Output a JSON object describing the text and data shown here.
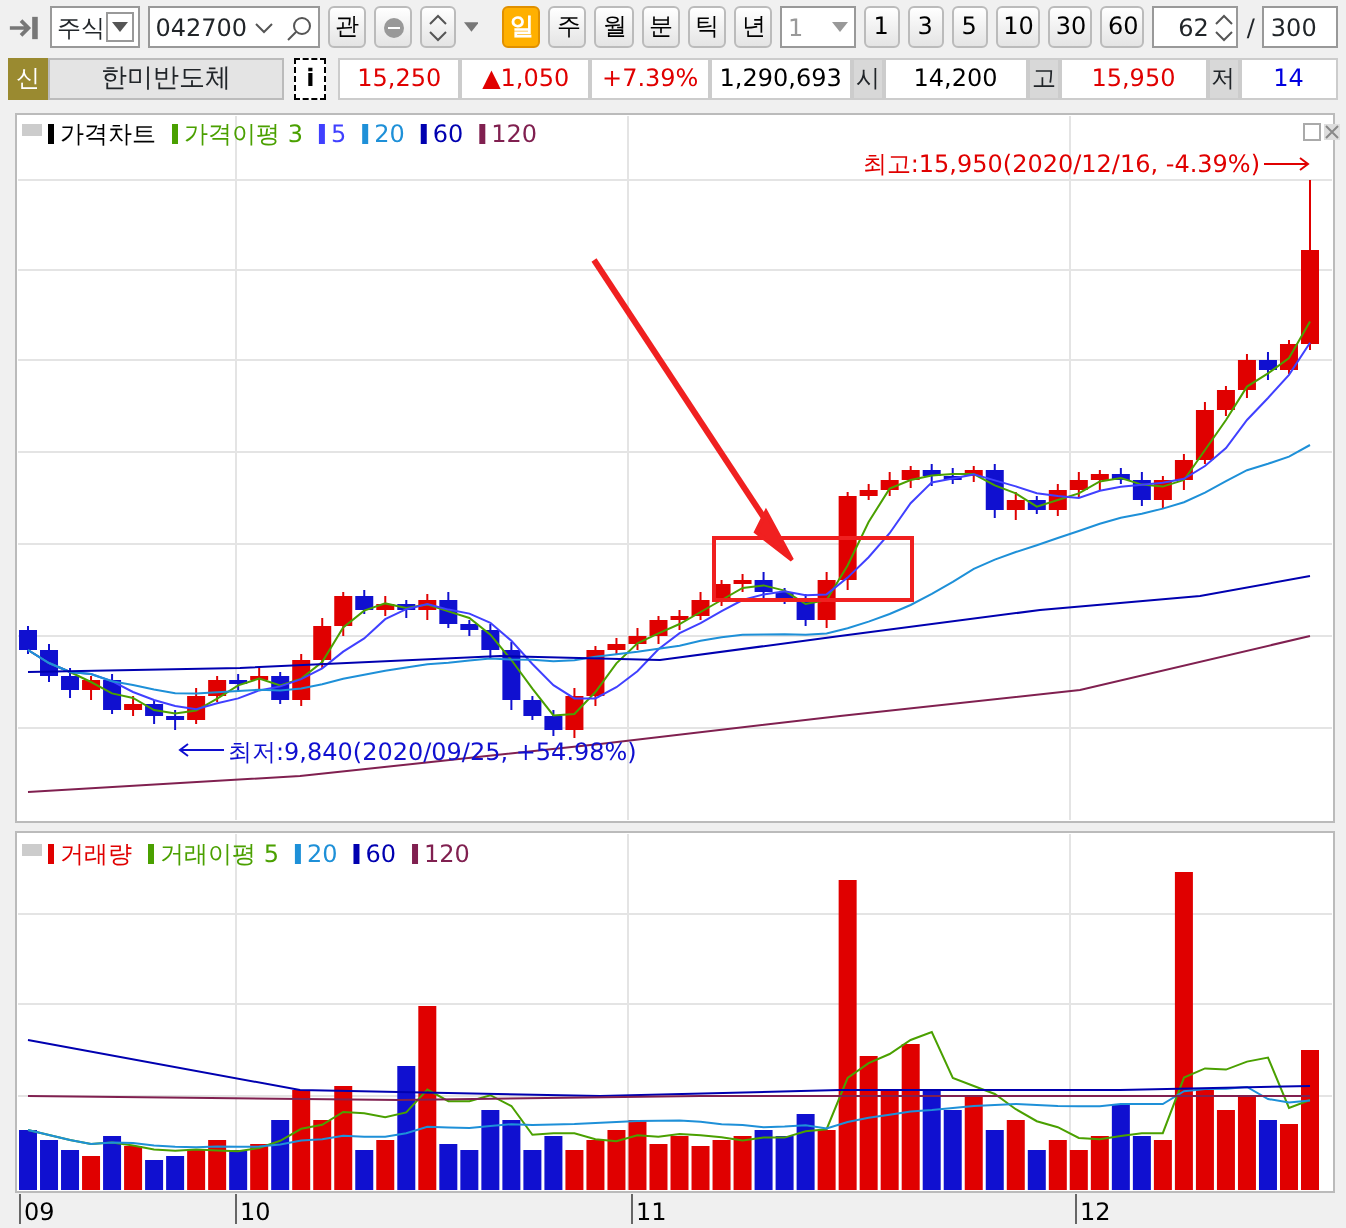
{
  "toolbar": {
    "market": "주식",
    "code": "042700",
    "watch_button": "관",
    "periods": [
      {
        "label": "일",
        "selected": true
      },
      {
        "label": "주",
        "selected": false
      },
      {
        "label": "월",
        "selected": false
      },
      {
        "label": "분",
        "selected": false
      },
      {
        "label": "틱",
        "selected": false
      },
      {
        "label": "년",
        "selected": false
      }
    ],
    "interval": "1",
    "interval_disabled": true,
    "intervals": [
      "1",
      "3",
      "5",
      "10",
      "30",
      "60"
    ],
    "count": "62",
    "separator": "/",
    "max_count": "300"
  },
  "quote": {
    "badge": "신",
    "name": "한미반도체",
    "info_button": "i",
    "cells": [
      {
        "kind": "value",
        "text": "15,250",
        "color": "#e00000"
      },
      {
        "kind": "value",
        "text": "▲1,050",
        "color": "#e00000"
      },
      {
        "kind": "value",
        "text": "+7.39%",
        "color": "#e00000"
      },
      {
        "kind": "value",
        "text": "1,290,693",
        "color": "#000000"
      },
      {
        "kind": "label",
        "text": "시"
      },
      {
        "kind": "value",
        "text": "14,200",
        "color": "#000000"
      },
      {
        "kind": "label",
        "text": "고"
      },
      {
        "kind": "value",
        "text": "15,950",
        "color": "#e00000"
      },
      {
        "kind": "label",
        "text": "저"
      },
      {
        "kind": "value",
        "text": "14",
        "color": "#0000e0"
      }
    ]
  },
  "price_chart": {
    "legend": [
      {
        "text": "가격차트",
        "color": "#000000"
      },
      {
        "text": "가격이평 3",
        "color": "#4aa000"
      },
      {
        "text": "5",
        "color": "#4040ff"
      },
      {
        "text": "20",
        "color": "#1e90d8"
      },
      {
        "text": "60",
        "color": "#0000b0"
      },
      {
        "text": "120",
        "color": "#802050"
      }
    ],
    "high_label": "최고:15,950(2020/12/16, -4.39%)",
    "low_label": "최저:9,840(2020/09/25, +54.98%)"
  },
  "volume_chart": {
    "legend": [
      {
        "text": "거래량",
        "color": "#e00000"
      },
      {
        "text": "거래이평 5",
        "color": "#4aa000"
      },
      {
        "text": "20",
        "color": "#1e90d8"
      },
      {
        "text": "60",
        "color": "#0000b0"
      },
      {
        "text": "120",
        "color": "#802050"
      }
    ]
  },
  "x_axis": [
    "09",
    "10",
    "11",
    "12"
  ]
}
